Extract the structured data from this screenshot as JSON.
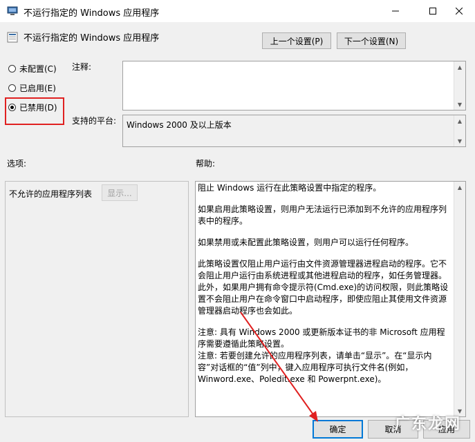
{
  "window": {
    "title": "不运行指定的 Windows 应用程序",
    "minimize_icon": "minimize-icon",
    "maximize_icon": "maximize-icon",
    "close_icon": "close-icon"
  },
  "header": {
    "title": "不运行指定的 Windows 应用程序",
    "prev_button": "上一个设置(P)",
    "next_button": "下一个设置(N)"
  },
  "state": {
    "options": [
      {
        "label": "未配置(C)",
        "selected": false
      },
      {
        "label": "已启用(E)",
        "selected": false
      },
      {
        "label": "已禁用(D)",
        "selected": true
      }
    ]
  },
  "comment": {
    "label": "注释:",
    "value": ""
  },
  "platform": {
    "label": "支持的平台:",
    "value": "Windows 2000 及以上版本"
  },
  "options_panel": {
    "label": "选项:",
    "item_label": "不允许的应用程序列表",
    "show_button": "显示..."
  },
  "help_panel": {
    "label": "帮助:",
    "paragraphs": [
      "阻止 Windows 运行在此策略设置中指定的程序。",
      "如果启用此策略设置，则用户无法运行已添加到不允许的应用程序列表中的程序。",
      "如果禁用或未配置此策略设置，则用户可以运行任何程序。",
      "此策略设置仅阻止用户运行由文件资源管理器进程启动的程序。它不会阻止用户运行由系统进程或其他进程启动的程序，如任务管理器。此外，如果用户拥有命令提示符(Cmd.exe)的访问权限，则此策略设置不会阻止用户在命令窗口中启动程序，即使应阻止其使用文件资源管理器启动程序也会如此。",
      "注意: 具有 Windows 2000 或更新版本证书的非 Microsoft 应用程序需要遵循此策略设置。",
      "注意: 若要创建允许的应用程序列表，请单击“显示”。在“显示内容”对话框的“值”列中，键入应用程序可执行文件名(例如，Winword.exe、Poledit.exe 和 Powerpnt.exe)。"
    ]
  },
  "footer": {
    "ok_button": "确定",
    "cancel_button": "取消",
    "apply_button": "应用"
  },
  "watermark": "广东龙网",
  "colors": {
    "accent": "#0078d7",
    "highlight": "#e02020"
  }
}
